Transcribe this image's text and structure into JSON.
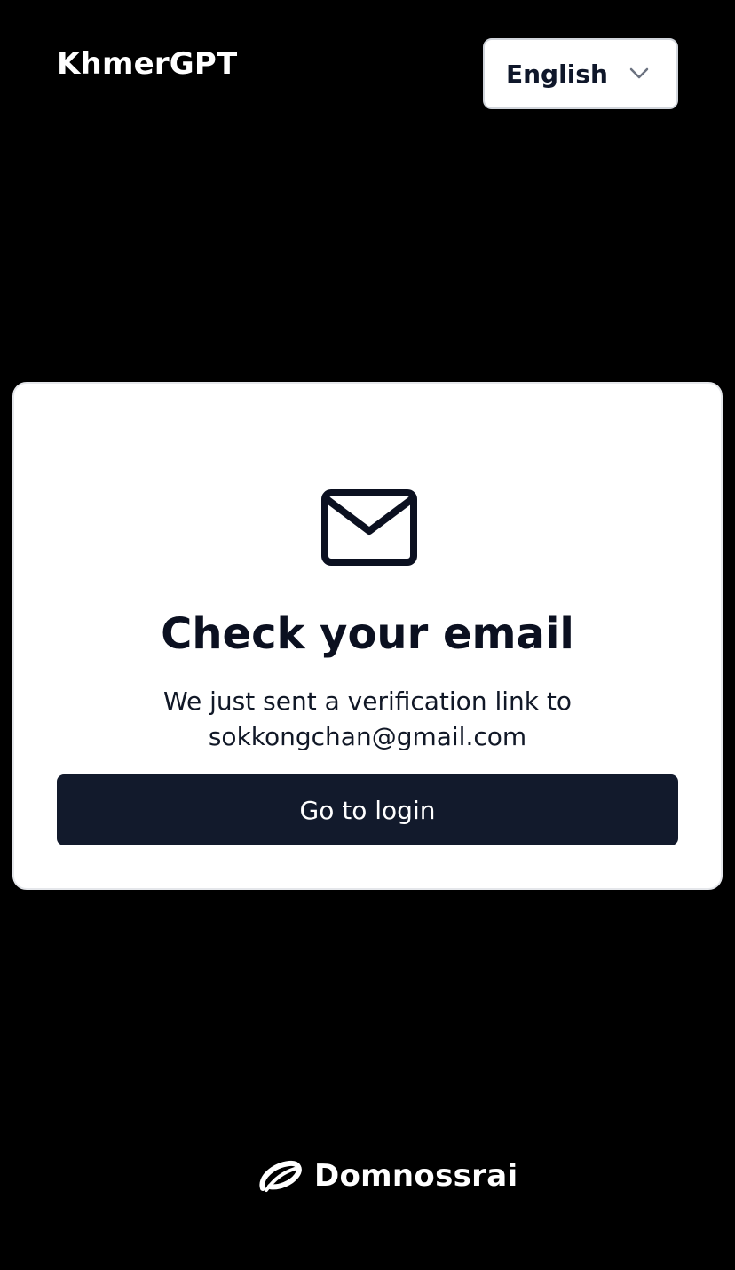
{
  "header": {
    "app_title": "KhmerGPT",
    "language": {
      "selected": "English",
      "icon": "chevron-down-icon"
    }
  },
  "card": {
    "icon": "mail-icon",
    "heading": "Check your email",
    "message_line1": "We just sent a verification link to",
    "email": "sokkongchan@gmail.com",
    "button_label": "Go to login"
  },
  "footer": {
    "brand_name": "Domnossrai",
    "logo_icon": "domnossrai-logo"
  },
  "colors": {
    "background": "#000000",
    "card": "#ffffff",
    "button": "#121a2c",
    "text_dark": "#0b1020"
  }
}
